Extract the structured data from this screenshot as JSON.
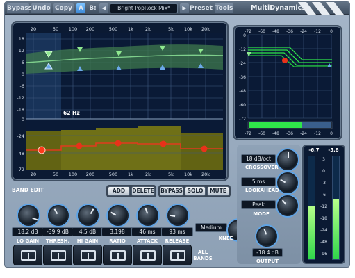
{
  "toolbar": {
    "bypass": "Bypass",
    "undo": "Undo",
    "copy": "Copy",
    "a": "A",
    "b": "B:",
    "preset_name": "Bright PopRock Mix*",
    "preset": "Preset",
    "tools": "Tools",
    "plugin_name": "MultiDynamics",
    "prev_icon": "triangle-left-icon",
    "next_icon": "triangle-right-icon"
  },
  "eq_display": {
    "freq_labels": [
      "20",
      "50",
      "100",
      "200",
      "500",
      "1k",
      "2k",
      "5k",
      "10k",
      "20k"
    ],
    "gain_labels": [
      "18",
      "12",
      "6",
      "0",
      "-6",
      "-12",
      "-18"
    ],
    "lower_labels": [
      "0",
      "-24",
      "-48",
      "-72"
    ],
    "cursor_readout": "62 Hz"
  },
  "transfer_display": {
    "x_labels": [
      "-72",
      "-60",
      "-48",
      "-36",
      "-24",
      "-12",
      "0"
    ],
    "y_labels": [
      "0",
      "-12",
      "-24",
      "-36",
      "-48",
      "-60",
      "-72"
    ],
    "bottom_labels": [
      "-72",
      "-60",
      "-48",
      "-36",
      "-24",
      "-12",
      "0"
    ]
  },
  "band_edit": {
    "title": "BAND EDIT",
    "add": "ADD",
    "delete": "DELETE",
    "bypass": "BYPASS",
    "solo": "SOLO",
    "mute": "MUTE"
  },
  "knobs": [
    {
      "label": "LO GAIN",
      "value": "18.2 dB"
    },
    {
      "label": "THRESH.",
      "value": "-39.9 dB"
    },
    {
      "label": "HI GAIN",
      "value": "4.5 dB"
    },
    {
      "label": "RATIO",
      "value": "3.198"
    },
    {
      "label": "ATTACK",
      "value": "46 ms"
    },
    {
      "label": "RELEASE",
      "value": "93 ms"
    }
  ],
  "knee": {
    "label": "KNEE",
    "value": "Medium"
  },
  "all_bands": "ALL BANDS",
  "crossover": {
    "label": "CROSSOVER",
    "value": "18 dB/oct"
  },
  "lookahead": {
    "label": "LOOKAHEAD",
    "value": "5 ms"
  },
  "mode": {
    "label": "MODE",
    "value": "Peak"
  },
  "output": {
    "label": "OUTPUT",
    "value": "-18.4 dB"
  },
  "meter": {
    "left_peak": "-6.7",
    "right_peak": "-5.8",
    "scale": [
      "3",
      "0",
      "-3",
      "-6",
      "-12",
      "-18",
      "-24",
      "-48",
      "-96"
    ]
  },
  "colors": {
    "accent_blue": "#5fa4e6",
    "band_fill": "#7a7a14",
    "band_line": "#e03a1e",
    "curve_green": "#2fe64a"
  }
}
